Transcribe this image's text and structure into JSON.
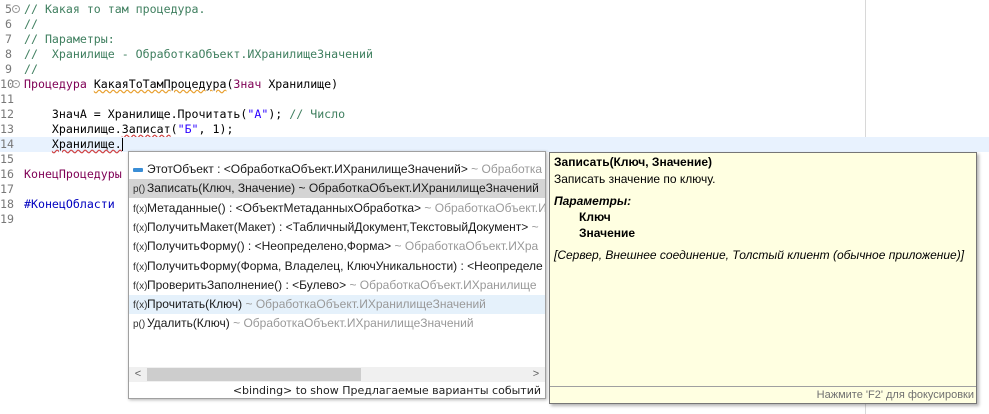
{
  "editor": {
    "lines": [
      {
        "n": "5",
        "fold": true,
        "tokens": [
          {
            "c": "c",
            "t": "// Какая то там процедура."
          }
        ]
      },
      {
        "n": "6",
        "tokens": [
          {
            "c": "c",
            "t": "//"
          }
        ]
      },
      {
        "n": "7",
        "tokens": [
          {
            "c": "c",
            "t": "// Параметры:"
          }
        ]
      },
      {
        "n": "8",
        "tokens": [
          {
            "c": "c",
            "t": "//  Хранилище - ОбработкаОбъект.ИХранилищеЗначений"
          }
        ]
      },
      {
        "n": "9",
        "tokens": [
          {
            "c": "c",
            "t": "//"
          }
        ]
      },
      {
        "n": "10",
        "fold": true,
        "tokens": [
          {
            "c": "k",
            "t": "Процедура"
          },
          {
            "c": "t",
            "t": " "
          },
          {
            "c": "t sq",
            "t": "КакаяТоТамПроцедура"
          },
          {
            "c": "t",
            "t": "("
          },
          {
            "c": "k",
            "t": "Знач"
          },
          {
            "c": "t",
            "t": " Хранилище)"
          }
        ]
      },
      {
        "n": "11",
        "tokens": []
      },
      {
        "n": "12",
        "tokens": [
          {
            "c": "t",
            "t": "    ЗначА = Хранилище.Прочитать("
          },
          {
            "c": "s",
            "t": "\"А\""
          },
          {
            "c": "t",
            "t": "); "
          },
          {
            "c": "c",
            "t": "// Число"
          }
        ]
      },
      {
        "n": "13",
        "tokens": [
          {
            "c": "t",
            "t": "    Хранилище."
          },
          {
            "c": "t sqr",
            "t": "Записат"
          },
          {
            "c": "t",
            "t": "("
          },
          {
            "c": "s",
            "t": "\"Б\""
          },
          {
            "c": "t",
            "t": ", 1);"
          }
        ]
      },
      {
        "n": "14",
        "current": true,
        "cursor": true,
        "tokens": [
          {
            "c": "t",
            "t": "    "
          },
          {
            "c": "t sqr",
            "t": "Хранилище."
          }
        ]
      },
      {
        "n": "15",
        "tokens": []
      },
      {
        "n": "16",
        "tokens": [
          {
            "c": "k",
            "t": "КонецПроцедуры"
          }
        ]
      },
      {
        "n": "17",
        "tokens": []
      },
      {
        "n": "18",
        "tokens": [
          {
            "c": "p",
            "t": "#КонецОбласти"
          }
        ]
      },
      {
        "n": "19",
        "tokens": []
      }
    ]
  },
  "autocomplete": {
    "items": [
      {
        "icon": "field",
        "main": "ЭтотОбъект : <ОбработкаОбъект.ИХранилищеЗначений>",
        "suffix": " ~ Обработка"
      },
      {
        "icon": "p()",
        "main": "Записать(Ключ, Значение) ~ ОбработкаОбъект.ИХранилищеЗначений",
        "suffix": "",
        "state": "sel"
      },
      {
        "icon": "f(x)",
        "main": "Метаданные() : <ОбъектМетаданныхОбработка>",
        "suffix": " ~ ОбработкаОбъект.И"
      },
      {
        "icon": "f(x)",
        "main": "ПолучитьМакет(Макет) : <ТабличныйДокумент,ТекстовыйДокумент>",
        "suffix": " ~"
      },
      {
        "icon": "f(x)",
        "main": "ПолучитьФорму() : <Неопределено,Форма>",
        "suffix": " ~ ОбработкаОбъект.ИХра"
      },
      {
        "icon": "f(x)",
        "main": "ПолучитьФорму(Форма, Владелец, КлючУникальности) : <Неопределе",
        "suffix": ""
      },
      {
        "icon": "f(x)",
        "main": "ПроверитьЗаполнение() : <Булево>",
        "suffix": " ~ ОбработкаОбъект.ИХранилище"
      },
      {
        "icon": "f(x)",
        "main": "Прочитать(Ключ)",
        "suffix": " ~ ОбработкаОбъект.ИХранилищеЗначений",
        "state": "hov"
      },
      {
        "icon": "p()",
        "main": "Удалить(Ключ)",
        "suffix": " ~ ОбработкаОбъект.ИХранилищеЗначений"
      }
    ],
    "scroll_left": "<",
    "scroll_right": ">",
    "status": "<binding> to show Предлагаемые варианты событий"
  },
  "info": {
    "title": "Записать(Ключ, Значение)",
    "description": "Записать значение по ключу.",
    "params_label": "Параметры:",
    "param1": "Ключ",
    "param2": "Значение",
    "context": "[Сервер, Внешнее соединение, Толстый клиент (обычное приложение)]",
    "focus_hint": "Нажмите 'F2' для фокусировки"
  }
}
